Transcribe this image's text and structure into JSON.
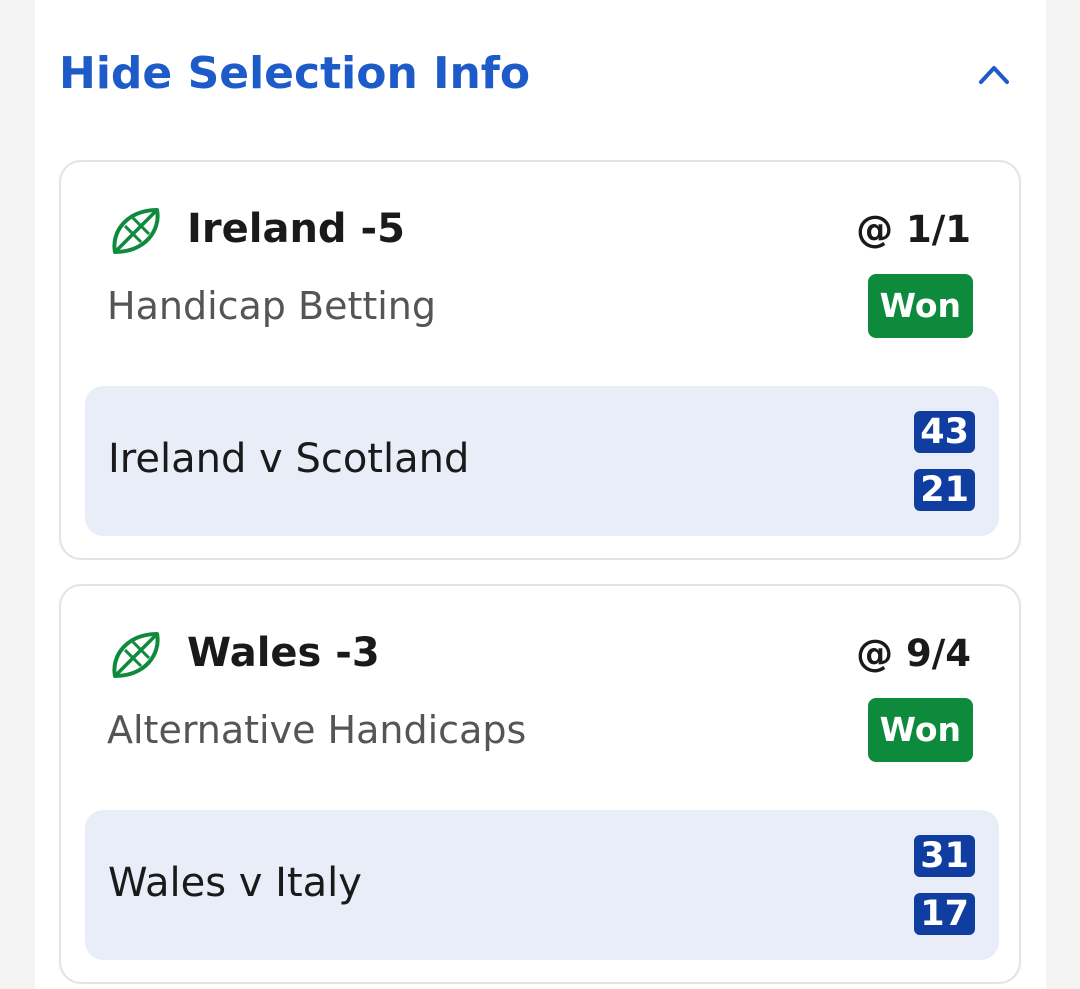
{
  "header": {
    "title": "Hide Selection Info",
    "toggle_icon": "chevron-up-icon"
  },
  "colors": {
    "accent": "#1d5bc9",
    "won": "#0d8a3c",
    "score_bg": "#0f3ea0",
    "event_bg": "#e8edf8",
    "icon_green": "#0d8a3c"
  },
  "selections": [
    {
      "icon": "rugby-ball-icon",
      "name": "Ireland -5",
      "odds": "@ 1/1",
      "market": "Handicap Betting",
      "result": "Won",
      "event": "Ireland v Scotland",
      "score_home": "43",
      "score_away": "21"
    },
    {
      "icon": "rugby-ball-icon",
      "name": "Wales -3",
      "odds": "@ 9/4",
      "market": "Alternative Handicaps",
      "result": "Won",
      "event": "Wales v Italy",
      "score_home": "31",
      "score_away": "17"
    }
  ]
}
